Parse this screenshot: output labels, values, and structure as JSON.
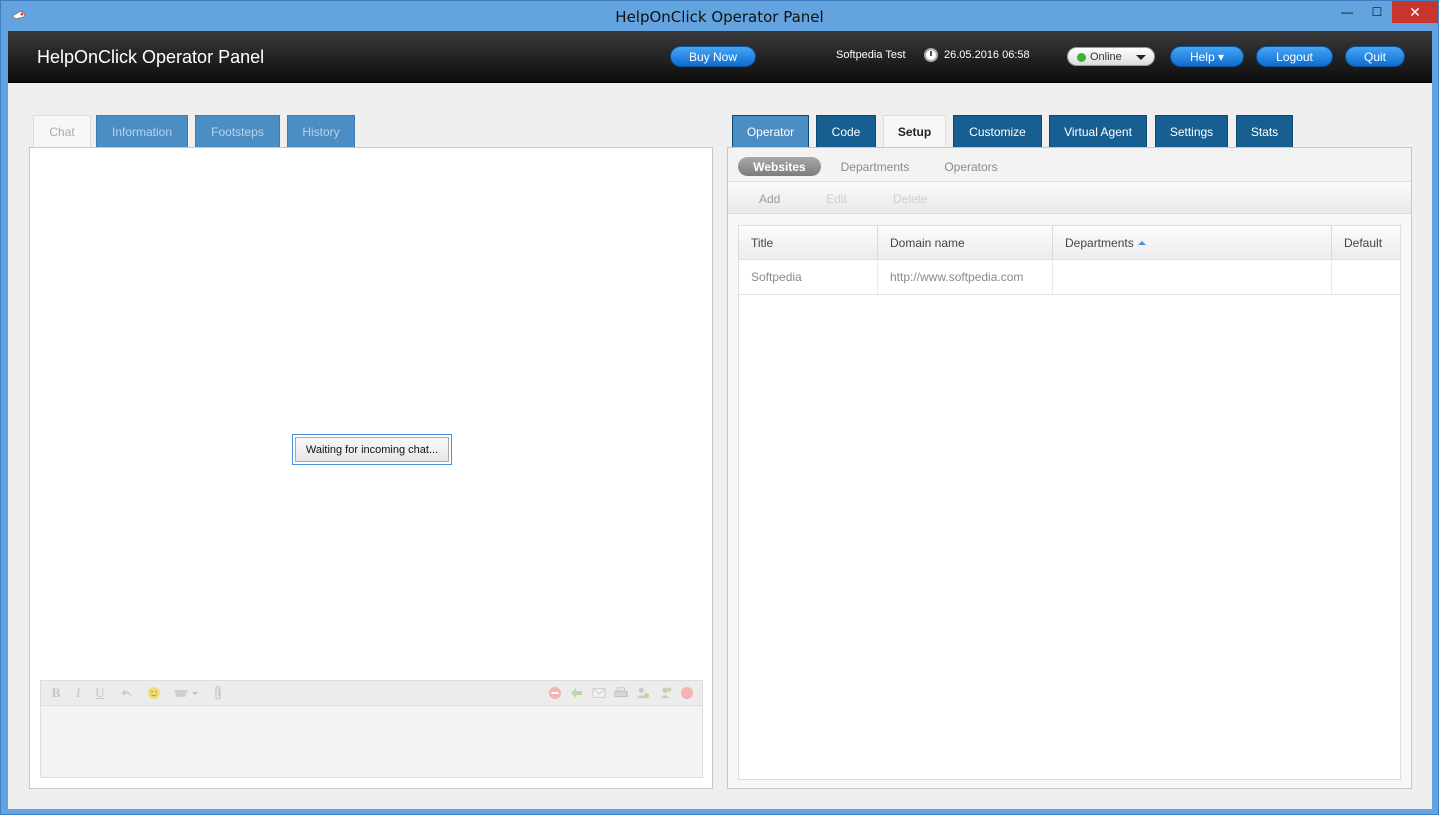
{
  "window": {
    "title": "HelpOnClick Operator Panel",
    "controls": {
      "minimize": "—",
      "maximize": "☐",
      "close": "✕"
    }
  },
  "header": {
    "app_title": "HelpOnClick Operator Panel",
    "buy_now": "Buy Now",
    "user": "Softpedia Test",
    "datetime": "26.05.2016 06:58",
    "status": "Online",
    "help": "Help ▾",
    "logout": "Logout",
    "quit": "Quit"
  },
  "left_tabs": [
    {
      "label": "Chat",
      "active": true
    },
    {
      "label": "Information",
      "active": false
    },
    {
      "label": "Footsteps",
      "active": false
    },
    {
      "label": "History",
      "active": false
    }
  ],
  "chat": {
    "waiting_message": "Waiting for incoming chat...",
    "editor_toolbar": {
      "bold": "B",
      "italic": "I",
      "underline": "U",
      "format_icons": [
        "undo-icon",
        "smiley-icon",
        "translate-icon",
        "attachment-icon"
      ],
      "action_icons": [
        "stop-icon",
        "transfer-icon",
        "email-icon",
        "print-icon",
        "invite-icon",
        "add-operator-icon",
        "close-chat-icon"
      ]
    }
  },
  "right_tabs": [
    {
      "label": "Operator",
      "active": false
    },
    {
      "label": "Code",
      "active": false
    },
    {
      "label": "Setup",
      "active": true
    },
    {
      "label": "Customize",
      "active": false
    },
    {
      "label": "Virtual Agent",
      "active": false
    },
    {
      "label": "Settings",
      "active": false
    },
    {
      "label": "Stats",
      "active": false
    }
  ],
  "setup": {
    "subtabs": [
      {
        "label": "Websites",
        "active": true
      },
      {
        "label": "Departments",
        "active": false
      },
      {
        "label": "Operators",
        "active": false
      }
    ],
    "actions": {
      "add": "Add",
      "edit": "Edit",
      "delete": "Delete"
    },
    "table": {
      "columns": [
        "Title",
        "Domain name",
        "Departments",
        "Default"
      ],
      "sorted_column": "Departments",
      "rows": [
        [
          "Softpedia",
          "http://www.softpedia.com",
          "",
          ""
        ]
      ]
    }
  },
  "colors": {
    "window_frame": "#63a4e0",
    "header_bg": "#1a1a1a",
    "button_blue": "#1a7ad9",
    "tab_dark": "#175f91",
    "tab_light": "#4c8ec4",
    "status_online": "#3bb03b"
  }
}
